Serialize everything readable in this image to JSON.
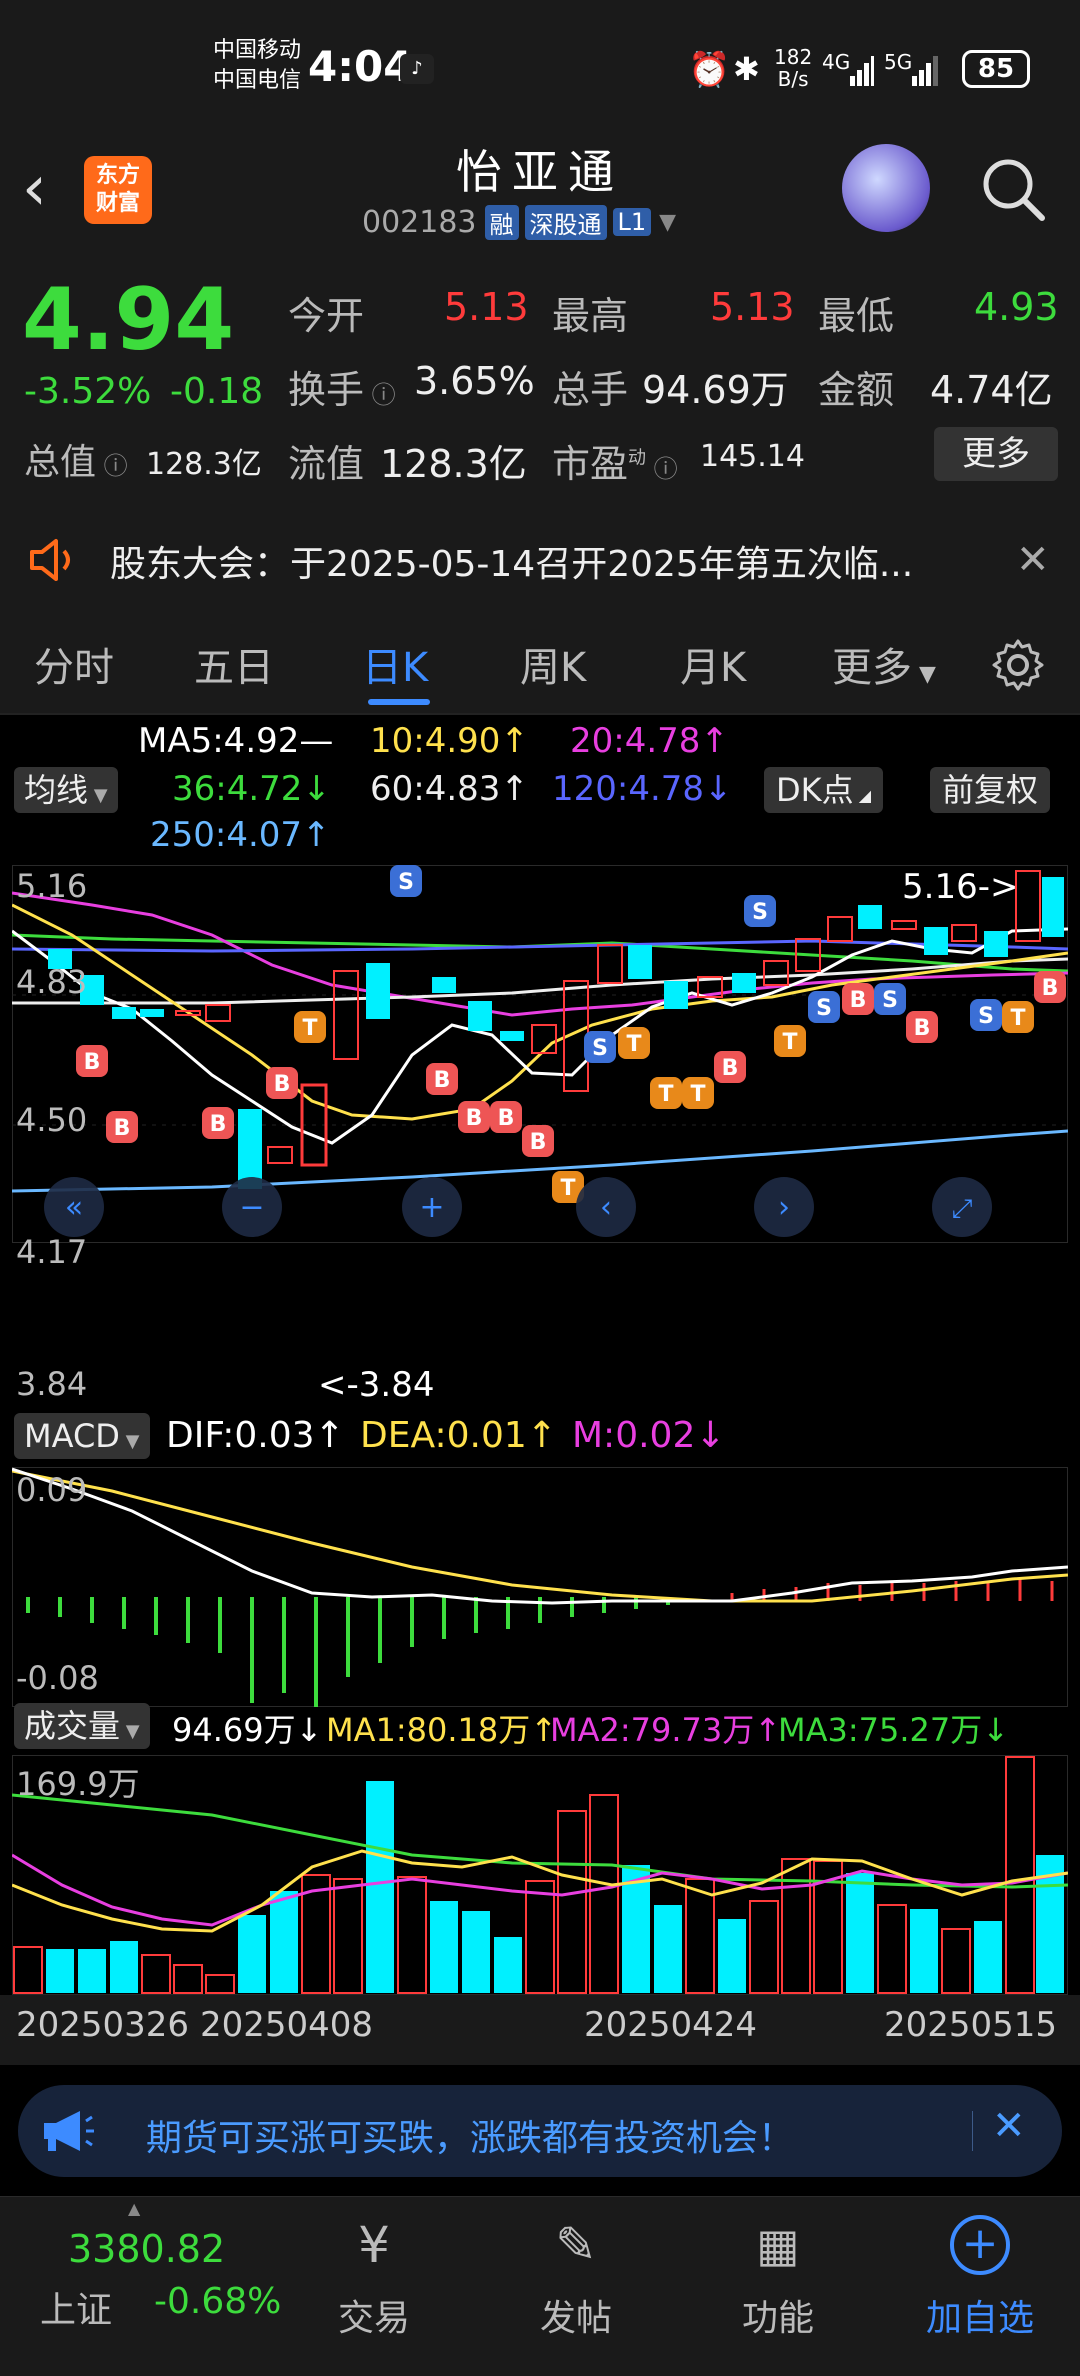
{
  "status": {
    "carrier1": "中国移动",
    "carrier2": "中国电信",
    "time": "4:04",
    "net_speed": "182",
    "net_unit": "B/s",
    "sig1": "4G",
    "sig2": "5G",
    "battery": "85"
  },
  "header": {
    "logo_line1": "东方",
    "logo_line2": "财富",
    "stock_name": "怡亚通",
    "stock_code": "002183",
    "tag_margin": "融",
    "tag_connect": "深股通",
    "tag_level": "L1"
  },
  "quote": {
    "price": "4.94",
    "change_pct": "-3.52%",
    "change_amt": "-0.18",
    "open_label": "今开",
    "open": "5.13",
    "high_label": "最高",
    "high": "5.13",
    "low_label": "最低",
    "low": "4.93",
    "turnover_label": "换手",
    "turnover": "3.65%",
    "volume_label": "总手",
    "volume": "94.69万",
    "amount_label": "金额",
    "amount": "4.74亿",
    "mktcap_label": "总值",
    "mktcap": "128.3亿",
    "float_label": "流值",
    "float_cap": "128.3亿",
    "pe_label": "市盈",
    "pe_sup": "动",
    "pe": "145.14",
    "more_button": "更多"
  },
  "notice": {
    "text": "股东大会：于2025-05-14召开2025年第五次临..."
  },
  "tabs": [
    "分时",
    "五日",
    "日K",
    "周K",
    "月K",
    "更多"
  ],
  "active_tab": 2,
  "ma_legend": {
    "selector": "均线",
    "ma5": "MA5:4.92—",
    "ma10": "10:4.90↑",
    "ma20": "20:4.78↑",
    "ma36": "36:4.72↓",
    "ma60": "60:4.83↑",
    "ma120": "120:4.78↓",
    "ma250": "250:4.07↑",
    "dk_button": "DK点",
    "adjust_button": "前复权"
  },
  "kline": {
    "y_top": "5.16",
    "y_2": "4.83",
    "y_3": "4.50",
    "y_4": "4.17",
    "y_bottom": "3.84",
    "high_marker": "5.16->",
    "low_marker": "<-3.84"
  },
  "macd": {
    "selector": "MACD",
    "dif": "DIF:0.03↑",
    "dea": "DEA:0.01↑",
    "m": "M:0.02↓",
    "y_top": "0.09",
    "y_bottom": "-0.08"
  },
  "volume": {
    "selector": "成交量",
    "vol": "94.69万↓",
    "ma1": "MA1:80.18万↑",
    "ma2": "MA2:79.73万↑",
    "ma3": "MA3:75.27万↓",
    "y_top": "169.9万"
  },
  "dates": [
    "20250326",
    "20250408",
    "20250424",
    "20250515"
  ],
  "ad": {
    "text": "期货可买涨可买跌，涨跌都有投资机会！"
  },
  "bottom_nav": {
    "index_value": "3380.82",
    "index_name": "上证",
    "index_change": "-0.68%",
    "items": [
      "交易",
      "发帖",
      "功能",
      "加自选"
    ]
  },
  "colors": {
    "up": "#ff3b3b",
    "down": "#00f0ff",
    "accent": "#3d8bff",
    "yellow": "#ffe14d",
    "magenta": "#e83fe0"
  }
}
